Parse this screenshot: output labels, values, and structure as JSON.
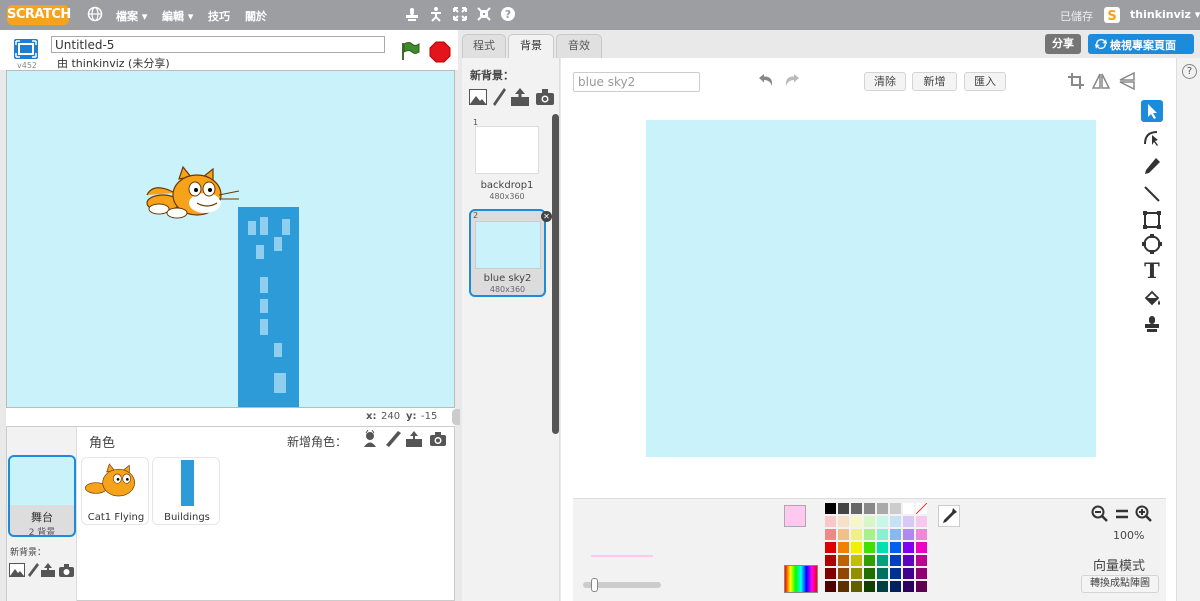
{
  "menu": {
    "logo": "SCRATCH",
    "items": [
      "檔案 ▾",
      "編輯 ▾",
      "技巧",
      "關於"
    ],
    "saved_status": "已儲存",
    "username": "thinkinviz ▾"
  },
  "project": {
    "title_value": "Untitled-5",
    "author_line": "由 thinkinviz (未分享)",
    "version": "v452"
  },
  "stage": {
    "x_label": "x:",
    "x_value": "240",
    "y_label": "y:",
    "y_value": "-15"
  },
  "sprites_panel": {
    "header": "角色",
    "new_sprite_label": "新增角色：",
    "stage_label": "舞台",
    "stage_backdrops": "2 背景",
    "new_backdrop_label": "新背景：",
    "sprites": [
      {
        "name": "Cat1 Flying"
      },
      {
        "name": "Buildings"
      }
    ]
  },
  "tabs": [
    "程式",
    "背景",
    "音效"
  ],
  "header_buttons": {
    "share": "分享",
    "see_project_page": "檢視專案頁面"
  },
  "backdrops_panel": {
    "new_backdrop_label": "新背景：",
    "items": [
      {
        "index": "1",
        "name": "backdrop1",
        "size": "480x360"
      },
      {
        "index": "2",
        "name": "blue sky2",
        "size": "480x360"
      }
    ]
  },
  "paint_editor": {
    "costume_name": "blue sky2",
    "clear": "清除",
    "add": "新增",
    "import": "匯入",
    "zoom_level": "100%",
    "mode_label": "向量模式",
    "convert_button": "轉換成點陣圖",
    "canvas_color": "#c9f2fb",
    "primary_color": "#ffc8f0"
  },
  "help_icon": "?"
}
